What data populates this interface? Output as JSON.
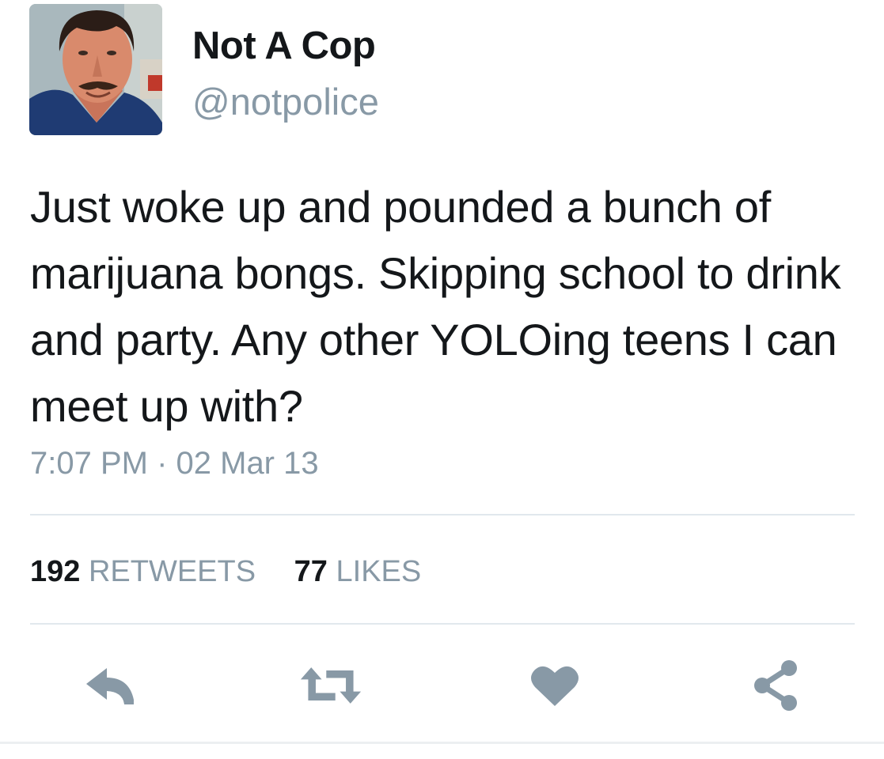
{
  "user": {
    "display_name": "Not A Cop",
    "handle": "@notpolice",
    "avatar_icon": "profile-photo-man-mustache"
  },
  "tweet": {
    "text": "Just woke up and pounded a bunch of marijuana bongs. Skipping school to drink and party. Any other YOLOing teens I can meet up with?",
    "timestamp": "7:07 PM · 02 Mar 13"
  },
  "stats": {
    "retweets_count": "192",
    "retweets_label": "RETWEETS",
    "likes_count": "77",
    "likes_label": "LIKES"
  },
  "actions": {
    "reply_icon": "reply-icon",
    "retweet_icon": "retweet-icon",
    "like_icon": "heart-icon",
    "share_icon": "share-icon"
  },
  "colors": {
    "text_primary": "#14171a",
    "text_secondary": "#8899a6",
    "divider": "#e1e8ed",
    "icon": "#8899a6"
  }
}
